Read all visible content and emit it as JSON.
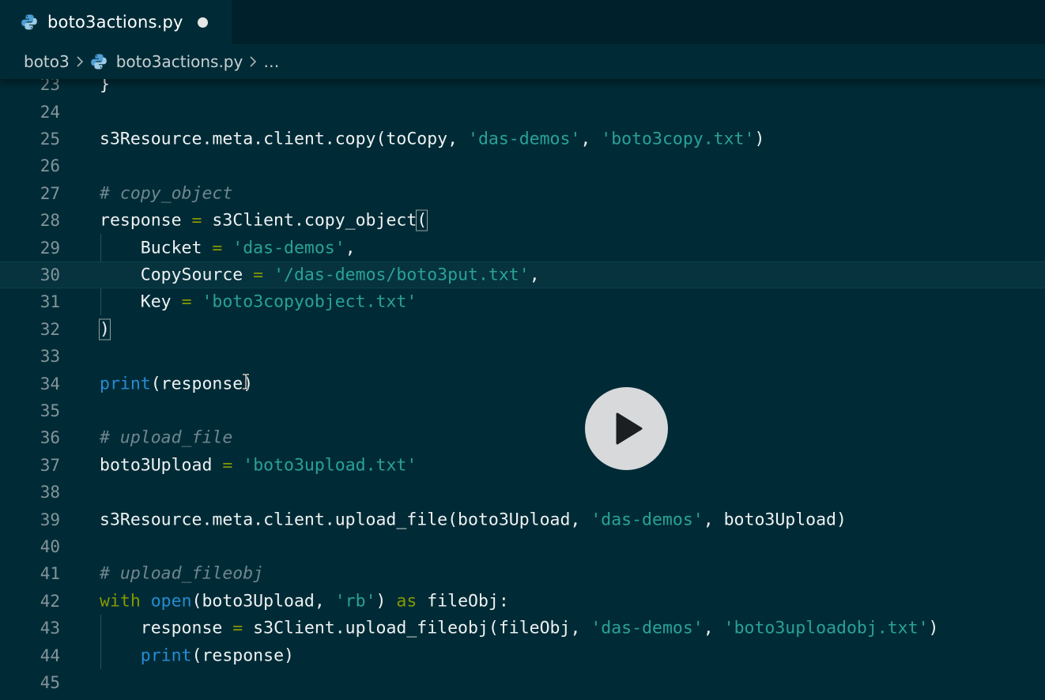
{
  "tab": {
    "title": "boto3actions.py",
    "icon": "python-icon",
    "unsaved": true
  },
  "breadcrumb": {
    "folder": "boto3",
    "file": "boto3actions.py",
    "more": "…"
  },
  "editor": {
    "current_line": 30,
    "lines": [
      {
        "n": 23,
        "tokens": [
          {
            "t": "}",
            "c": "default"
          }
        ]
      },
      {
        "n": 24,
        "tokens": []
      },
      {
        "n": 25,
        "tokens": [
          {
            "t": "s3Resource.meta.client.copy(toCopy, ",
            "c": "default"
          },
          {
            "t": "'das-demos'",
            "c": "str"
          },
          {
            "t": ", ",
            "c": "default"
          },
          {
            "t": "'boto3copy.txt'",
            "c": "str"
          },
          {
            "t": ")",
            "c": "default"
          }
        ]
      },
      {
        "n": 26,
        "tokens": []
      },
      {
        "n": 27,
        "tokens": [
          {
            "t": "# copy_object",
            "c": "comment"
          }
        ]
      },
      {
        "n": 28,
        "tokens": [
          {
            "t": "response ",
            "c": "default"
          },
          {
            "t": "=",
            "c": "op"
          },
          {
            "t": " s3Client.copy_object",
            "c": "default"
          },
          {
            "t": "(",
            "c": "bracket"
          }
        ]
      },
      {
        "n": 29,
        "tokens": [
          {
            "t": "    Bucket ",
            "c": "default"
          },
          {
            "t": "=",
            "c": "op"
          },
          {
            "t": " ",
            "c": "default"
          },
          {
            "t": "'das-demos'",
            "c": "str"
          },
          {
            "t": ",",
            "c": "default"
          }
        ]
      },
      {
        "n": 30,
        "tokens": [
          {
            "t": "    CopySource ",
            "c": "default"
          },
          {
            "t": "=",
            "c": "op"
          },
          {
            "t": " ",
            "c": "default"
          },
          {
            "t": "'/das-demos/boto3put.txt'",
            "c": "str"
          },
          {
            "t": ",",
            "c": "default"
          }
        ]
      },
      {
        "n": 31,
        "tokens": [
          {
            "t": "    Key ",
            "c": "default"
          },
          {
            "t": "=",
            "c": "op"
          },
          {
            "t": " ",
            "c": "default"
          },
          {
            "t": "'boto3copyobject.txt'",
            "c": "str"
          }
        ]
      },
      {
        "n": 32,
        "tokens": [
          {
            "t": ")",
            "c": "bracket"
          }
        ]
      },
      {
        "n": 33,
        "tokens": []
      },
      {
        "n": 34,
        "tokens": [
          {
            "t": "print",
            "c": "builtin"
          },
          {
            "t": "(response)",
            "c": "default"
          }
        ]
      },
      {
        "n": 35,
        "tokens": []
      },
      {
        "n": 36,
        "tokens": [
          {
            "t": "# upload_file",
            "c": "comment"
          }
        ]
      },
      {
        "n": 37,
        "tokens": [
          {
            "t": "boto3Upload ",
            "c": "default"
          },
          {
            "t": "=",
            "c": "op"
          },
          {
            "t": " ",
            "c": "default"
          },
          {
            "t": "'boto3upload.txt'",
            "c": "str"
          }
        ]
      },
      {
        "n": 38,
        "tokens": []
      },
      {
        "n": 39,
        "tokens": [
          {
            "t": "s3Resource.meta.client.upload_file(boto3Upload, ",
            "c": "default"
          },
          {
            "t": "'das-demos'",
            "c": "str"
          },
          {
            "t": ", boto3Upload)",
            "c": "default"
          }
        ]
      },
      {
        "n": 40,
        "tokens": []
      },
      {
        "n": 41,
        "tokens": [
          {
            "t": "# upload_fileobj",
            "c": "comment"
          }
        ]
      },
      {
        "n": 42,
        "tokens": [
          {
            "t": "with",
            "c": "kw"
          },
          {
            "t": " ",
            "c": "default"
          },
          {
            "t": "open",
            "c": "builtin"
          },
          {
            "t": "(boto3Upload, ",
            "c": "default"
          },
          {
            "t": "'rb'",
            "c": "str"
          },
          {
            "t": ") ",
            "c": "default"
          },
          {
            "t": "as",
            "c": "kw"
          },
          {
            "t": " fileObj:",
            "c": "default"
          }
        ]
      },
      {
        "n": 43,
        "tokens": [
          {
            "t": "    response ",
            "c": "default"
          },
          {
            "t": "=",
            "c": "op"
          },
          {
            "t": " s3Client.upload_fileobj(fileObj, ",
            "c": "default"
          },
          {
            "t": "'das-demos'",
            "c": "str"
          },
          {
            "t": ", ",
            "c": "default"
          },
          {
            "t": "'boto3uploadobj.txt'",
            "c": "str"
          },
          {
            "t": ")",
            "c": "default"
          }
        ]
      },
      {
        "n": 44,
        "tokens": [
          {
            "t": "    ",
            "c": "default"
          },
          {
            "t": "print",
            "c": "builtin"
          },
          {
            "t": "(response)",
            "c": "default"
          }
        ]
      },
      {
        "n": 45,
        "tokens": []
      }
    ]
  },
  "colors": {
    "background": "#002b36",
    "tabbar": "#00212b",
    "string": "#2aa198",
    "keyword": "#859900",
    "builtin": "#268bd2",
    "comment": "#6f8791",
    "line_number": "#83949a"
  },
  "overlay": {
    "play_icon": "play-icon"
  }
}
